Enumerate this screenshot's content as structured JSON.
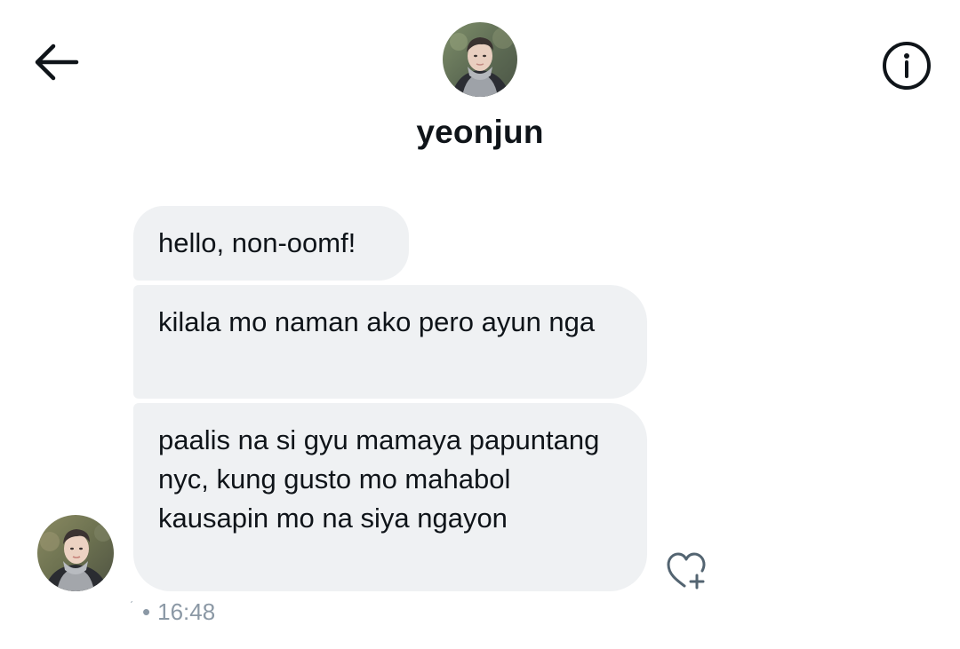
{
  "header": {
    "title": "yeonjun",
    "back_icon": "arrow-left-icon",
    "info_icon": "info-circle-icon"
  },
  "messages": [
    {
      "text": "hello, non-oomf!"
    },
    {
      "text": "kilala mo naman ako pero ayun nga"
    },
    {
      "text": "paalis na si gyu mamaya papuntang nyc, kung gusto mo mahabol kausapin mo na siya ngayon"
    }
  ],
  "meta": {
    "seen_mark": "ˊ",
    "separator": "•",
    "time": "16:48"
  },
  "reaction": {
    "icon": "heart-plus-icon"
  },
  "colors": {
    "bubble": "#eff1f3",
    "text": "#0f1419",
    "muted": "#8b98a5"
  }
}
